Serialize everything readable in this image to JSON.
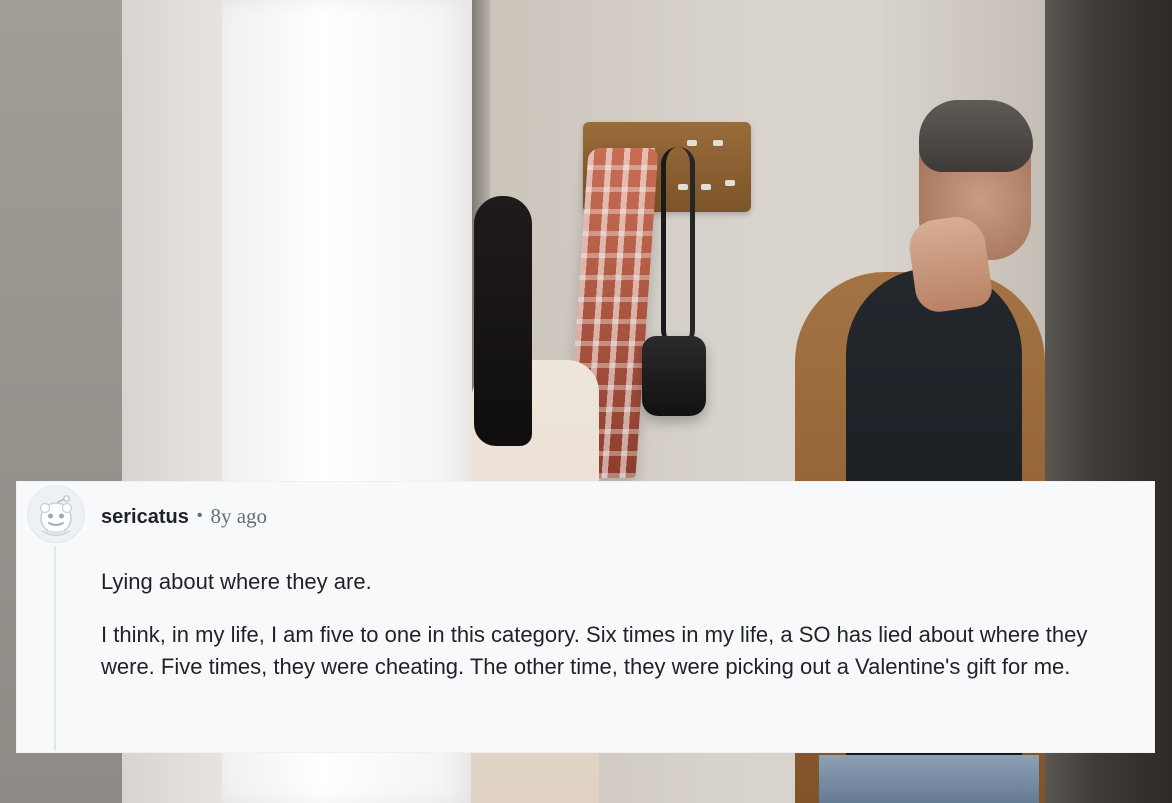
{
  "comment": {
    "username": "sericatus",
    "separator": "•",
    "age": "8y ago",
    "paragraphs": [
      "Lying about where they are.",
      "I think, in my life, I am five to one in this category. Six times in my life, a SO has lied about where they were. Five times, they were cheating. The other time, they were picking out a Valentine's gift for me."
    ],
    "avatar_icon": "snoo-avatar-icon"
  },
  "colors": {
    "card_background": "#f8f9fa",
    "text": "#1f2328",
    "meta": "#576f76",
    "thread_line": "#e4e7ea"
  }
}
